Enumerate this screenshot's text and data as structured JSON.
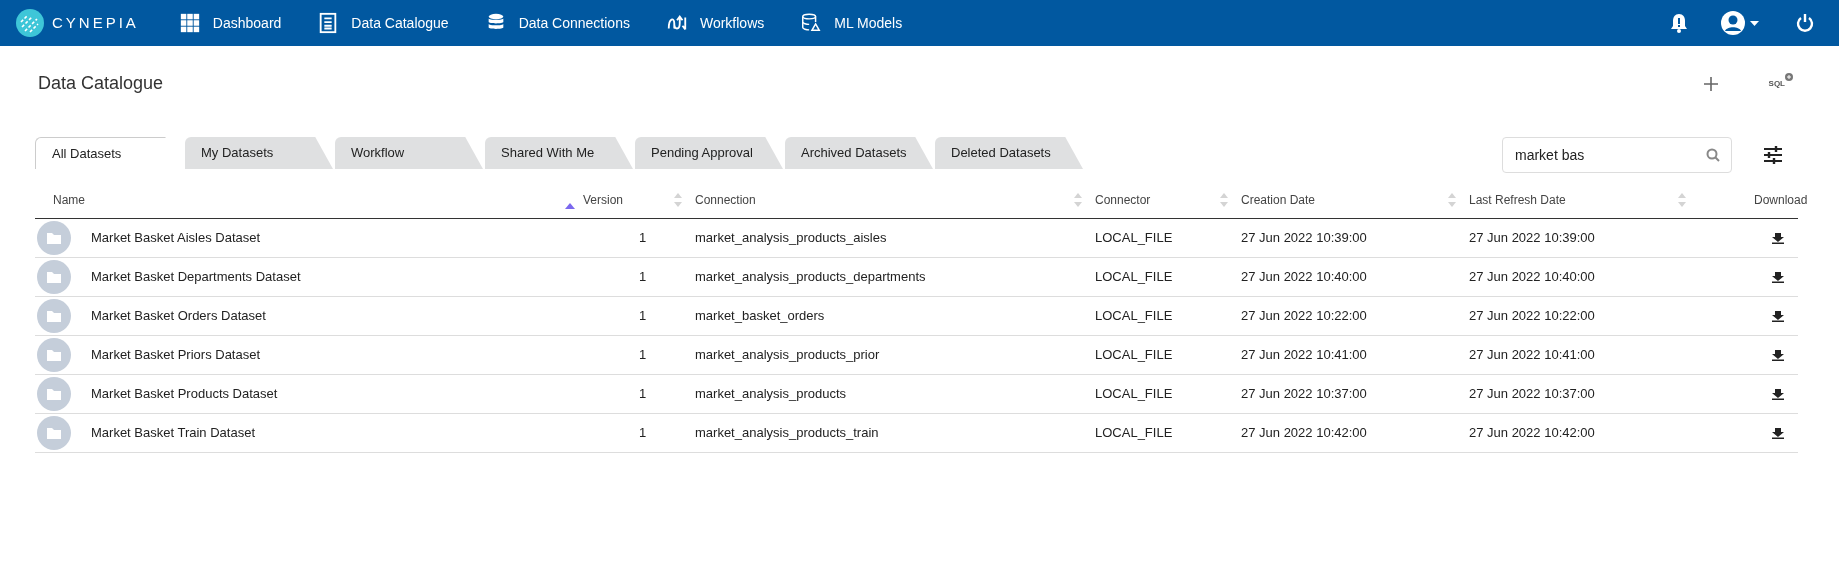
{
  "nav": {
    "brand": "CYNEPIA",
    "items": [
      {
        "label": "Dashboard",
        "kind": "grid"
      },
      {
        "label": "Data Catalogue",
        "kind": "document"
      },
      {
        "label": "Data Connections",
        "kind": "database"
      },
      {
        "label": "Workflows",
        "kind": "flow"
      },
      {
        "label": "ML Models",
        "kind": "model"
      }
    ]
  },
  "page": {
    "title": "Data Catalogue",
    "sql_label": "SQL"
  },
  "tabs": [
    {
      "label": "All Datasets",
      "selected": true
    },
    {
      "label": "My Datasets",
      "selected": false
    },
    {
      "label": "Workflow",
      "selected": false
    },
    {
      "label": "Shared With Me",
      "selected": false
    },
    {
      "label": "Pending Approval",
      "selected": false
    },
    {
      "label": "Archived Datasets",
      "selected": false
    },
    {
      "label": "Deleted Datasets",
      "selected": false
    }
  ],
  "search": {
    "value": "market bas"
  },
  "table": {
    "columns": [
      {
        "label": "Name",
        "kind": "sortable",
        "sorted": true
      },
      {
        "label": "Version",
        "kind": "sortable",
        "sorted": false
      },
      {
        "label": "Connection",
        "kind": "sortable",
        "sorted": false
      },
      {
        "label": "Connector",
        "kind": "sortable",
        "sorted": false
      },
      {
        "label": "Creation Date",
        "kind": "sortable",
        "sorted": false
      },
      {
        "label": "Last Refresh Date",
        "kind": "sortable",
        "sorted": false
      },
      {
        "label": "Download",
        "kind": "plain"
      }
    ],
    "rows": [
      {
        "name": "Market Basket Aisles Dataset",
        "version": "1",
        "connection": "market_analysis_products_aisles",
        "connector": "LOCAL_FILE",
        "created": "27 Jun 2022 10:39:00",
        "refreshed": "27 Jun 2022 10:39:00"
      },
      {
        "name": "Market Basket Departments Dataset",
        "version": "1",
        "connection": "market_analysis_products_departments",
        "connector": "LOCAL_FILE",
        "created": "27 Jun 2022 10:40:00",
        "refreshed": "27 Jun 2022 10:40:00"
      },
      {
        "name": "Market Basket Orders Dataset",
        "version": "1",
        "connection": "market_basket_orders",
        "connector": "LOCAL_FILE",
        "created": "27 Jun 2022 10:22:00",
        "refreshed": "27 Jun 2022 10:22:00"
      },
      {
        "name": "Market Basket Priors Dataset",
        "version": "1",
        "connection": "market_analysis_products_prior",
        "connector": "LOCAL_FILE",
        "created": "27 Jun 2022 10:41:00",
        "refreshed": "27 Jun 2022 10:41:00"
      },
      {
        "name": "Market Basket Products Dataset",
        "version": "1",
        "connection": "market_analysis_products",
        "connector": "LOCAL_FILE",
        "created": "27 Jun 2022 10:37:00",
        "refreshed": "27 Jun 2022 10:37:00"
      },
      {
        "name": "Market Basket Train Dataset",
        "version": "1",
        "connection": "market_analysis_products_train",
        "connector": "LOCAL_FILE",
        "created": "27 Jun 2022 10:42:00",
        "refreshed": "27 Jun 2022 10:42:00"
      }
    ]
  }
}
